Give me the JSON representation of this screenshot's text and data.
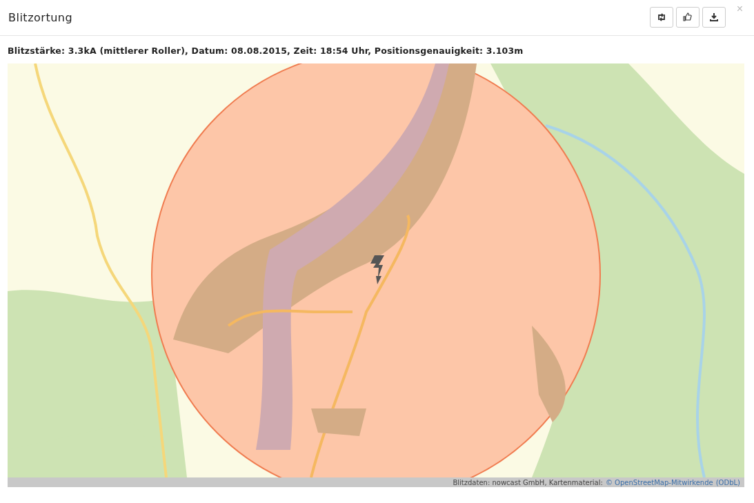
{
  "dialog": {
    "title": "Blitzortung",
    "close": "×"
  },
  "info": "Blitzstärke: 3.3kA (mittlerer Roller), Datum: 08.08.2015, Zeit: 18:54 Uhr, Positionsgenauigkeit: 3.103m",
  "map": {
    "kind": "picture",
    "attribution": {
      "text": "Blitzdaten: nowcast GmbH, Kartenmaterial:",
      "link": "© OpenStreetMap-Mitwirkende",
      "license": "(ODbL)"
    }
  }
}
